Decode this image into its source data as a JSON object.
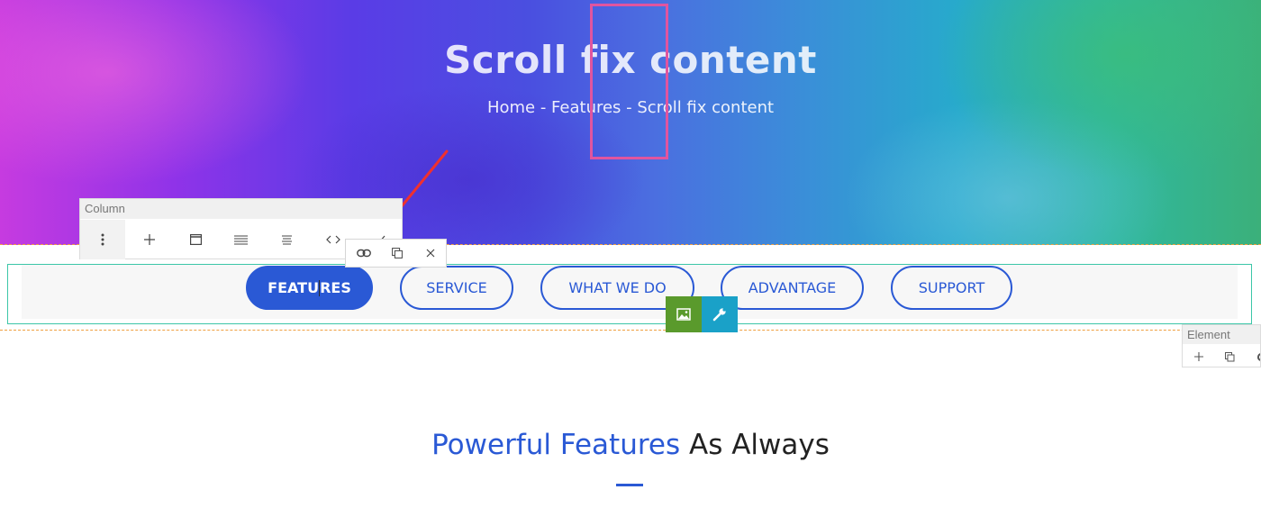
{
  "hero": {
    "title": "Scroll fix content",
    "breadcrumb": "Home - Features - Scroll fix content"
  },
  "tabs": [
    {
      "label": "FEATURES",
      "active": true
    },
    {
      "label": "SERVICE",
      "active": false
    },
    {
      "label": "WHAT WE DO",
      "active": false
    },
    {
      "label": "ADVANTAGE",
      "active": false
    },
    {
      "label": "SUPPORT",
      "active": false
    }
  ],
  "column_toolbar": {
    "label": "Column",
    "icons": [
      "more-vertical-icon",
      "plus-icon",
      "window-icon",
      "align-justify-icon",
      "align-center-icon",
      "code-icon"
    ]
  },
  "sub_toolbar": {
    "icons": [
      "link-icon",
      "copy-icon",
      "close-icon"
    ]
  },
  "element_toolbar": {
    "label": "Element",
    "icons": [
      "plus-icon",
      "copy-icon",
      "settings-icon"
    ]
  },
  "element_actions": {
    "icons": [
      "image-icon",
      "wrench-icon"
    ]
  },
  "section": {
    "heading_accent": "Powerful Features",
    "heading_rest": " As Always"
  },
  "colors": {
    "accent": "#2a59d5",
    "highlight": "#e0559f",
    "row_outline": "#3cc6a8",
    "image_button": "#5a9a2c",
    "wrench_button": "#1aa1c8",
    "annotation_arrow": "#f0302e"
  }
}
